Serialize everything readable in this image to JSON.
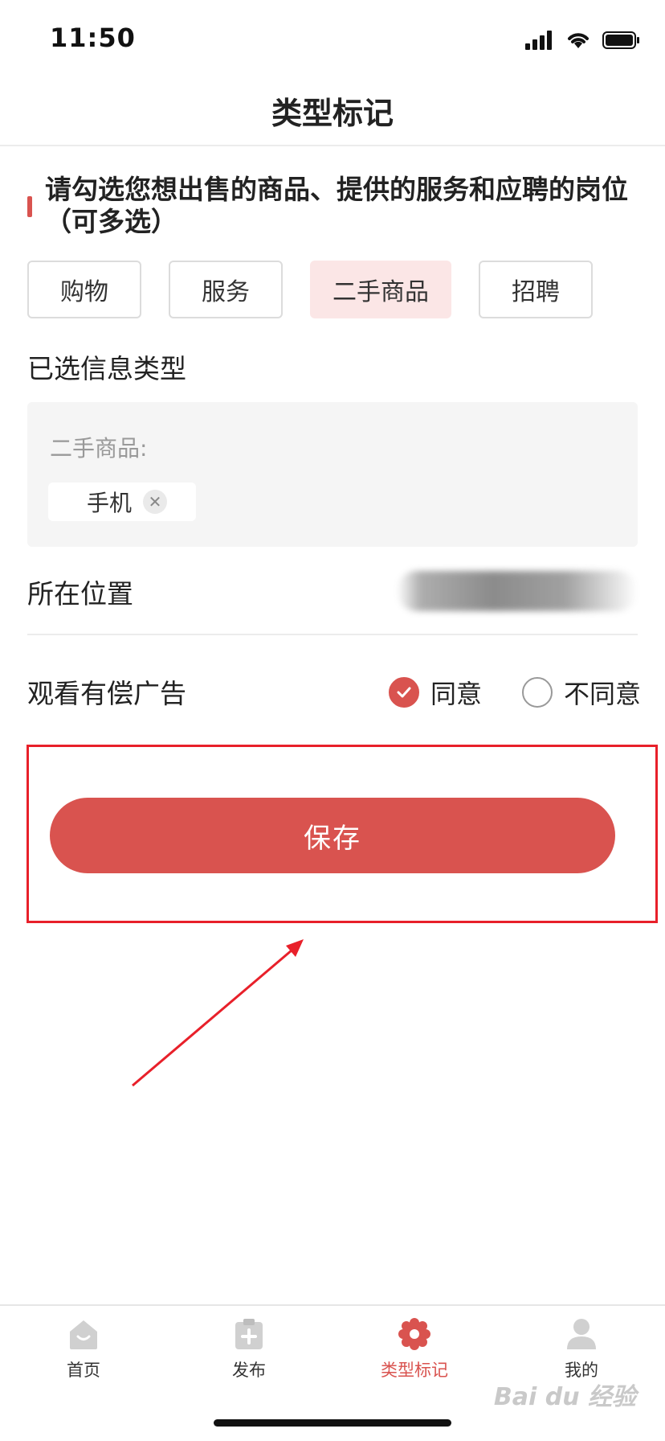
{
  "status": {
    "time": "11:50"
  },
  "nav": {
    "title": "类型标记"
  },
  "section": {
    "heading": "请勾选您想出售的商品、提供的服务和应聘的岗位（可多选）"
  },
  "types": [
    {
      "label": "购物",
      "selected": false
    },
    {
      "label": "服务",
      "selected": false
    },
    {
      "label": "二手商品",
      "selected": true
    },
    {
      "label": "招聘",
      "selected": false
    }
  ],
  "selected_info": {
    "title": "已选信息类型",
    "category": "二手商品:",
    "tags": [
      {
        "label": "手机"
      }
    ]
  },
  "location": {
    "label": "所在位置"
  },
  "ads": {
    "label": "观看有偿广告",
    "options": [
      {
        "label": "同意",
        "checked": true
      },
      {
        "label": "不同意",
        "checked": false
      }
    ]
  },
  "save_button": {
    "label": "保存"
  },
  "tabbar": {
    "items": [
      {
        "label": "首页",
        "icon": "home-icon",
        "active": false
      },
      {
        "label": "发布",
        "icon": "publish-icon",
        "active": false
      },
      {
        "label": "类型标记",
        "icon": "flower-icon",
        "active": true
      },
      {
        "label": "我的",
        "icon": "user-icon",
        "active": false
      }
    ]
  },
  "colors": {
    "accent": "#d9534f",
    "selected_bg": "#fbe6e6",
    "annotation": "#e8202a"
  }
}
